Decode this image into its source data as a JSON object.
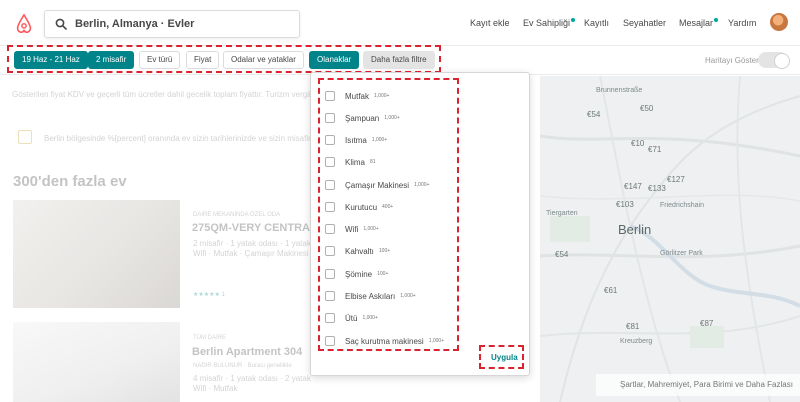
{
  "header": {
    "search_text": "Berlin, Almanya · Evler",
    "nav": {
      "add_listing": "Kayıt ekle",
      "host": "Ev Sahipliği",
      "saved": "Kayıtlı",
      "trips": "Seyahatler",
      "messages": "Mesajlar",
      "help": "Yardım"
    }
  },
  "filters": {
    "dates": "19 Haz - 21 Haz",
    "guests": "2 misafir",
    "home_type": "Ev türü",
    "price": "Fiyat",
    "rooms_beds": "Odalar ve yataklar",
    "amenities": "Olanaklar",
    "more_filters": "Daha fazla filtre",
    "show_map": "Haritayı Göster"
  },
  "amenities": {
    "items": [
      {
        "name": "Mutfak",
        "count": "1,000+"
      },
      {
        "name": "Şampuan",
        "count": "1,000+"
      },
      {
        "name": "Isıtma",
        "count": "1,000+"
      },
      {
        "name": "Klima",
        "count": "81"
      },
      {
        "name": "Çamaşır Makinesi",
        "count": "1,000+"
      },
      {
        "name": "Kurutucu",
        "count": "400+"
      },
      {
        "name": "Wifi",
        "count": "1,000+"
      },
      {
        "name": "Kahvaltı",
        "count": "100+"
      },
      {
        "name": "Şömine",
        "count": "100+"
      },
      {
        "name": "Elbise Askıları",
        "count": "1,000+"
      },
      {
        "name": "Ütü",
        "count": "1,000+"
      },
      {
        "name": "Saç kurutma makinesi",
        "count": "1,000+"
      }
    ],
    "apply_label": "Uygula"
  },
  "background": {
    "price_note": "Gösterilen fiyat KDV ve geçerli tüm ücretler dahil gecelik toplam fiyattır. Turizm vergileri",
    "banner": "Berlin bölgesinde %[percent] oranında ev sizin tarihlerinizde ve sizin misafir",
    "results_heading": "300'den fazla ev",
    "listing1": {
      "type": "DAIRE MEKANINDA ÖZEL ODA",
      "title": "275QM-VERY CENTRAL-",
      "details": "2 misafir · 1 yatak odası · 1 yatak",
      "amenities": "Wifi · Mutfak · Çamaşır Makinesi",
      "rating": "★★★★★ 1"
    },
    "listing2": {
      "type": "TÜM DAİRE",
      "title": "Berlin Apartment 304",
      "badge": "NADIR BULUNUR · Burası genellikle",
      "details": "4 misafir · 1 yatak odası · 2 yatak",
      "amenities": "Wifi · Mutfak"
    }
  },
  "map": {
    "city": "Berlin",
    "prices": [
      "€54",
      "€50",
      "€10",
      "€71",
      "€147",
      "€133",
      "€127",
      "€103",
      "€54",
      "€61",
      "€81",
      "€87"
    ],
    "places": [
      "Brunnenstraße",
      "Tiergarten",
      "Friedrichshain",
      "Kreuzberg",
      "Görlitzer Park"
    ],
    "footer": "Şartlar, Mahremiyet, Para Birimi ve Daha Fazlası"
  },
  "colors": {
    "brand": "#FF5A5F",
    "active_chip": "#008489",
    "annotation": "#D9232F"
  }
}
